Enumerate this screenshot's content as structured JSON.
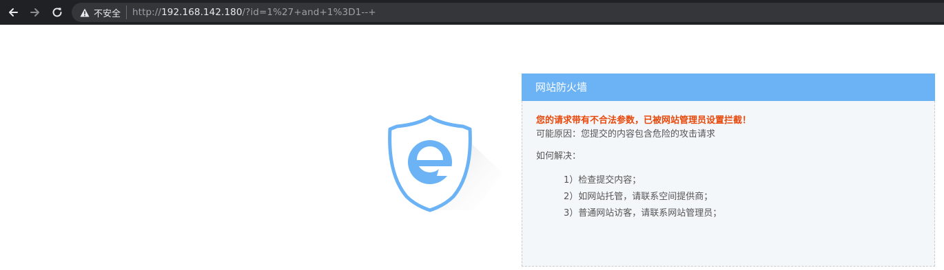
{
  "browser": {
    "security_label": "不安全",
    "url": {
      "scheme": "http://",
      "host": "192.168.142.180",
      "rest": "/?id=1%27+and+1%3D1--+"
    }
  },
  "icons": [
    "back-arrow-icon",
    "forward-arrow-icon",
    "reload-icon",
    "warning-icon",
    "shield-e-logo"
  ],
  "colors": {
    "panel_header": "#6cb3f6",
    "warning_text": "#e8480a",
    "shield": "#6cb3f6"
  },
  "panel": {
    "title": "网站防火墙",
    "warning": "您的请求带有不合法参数，已被网站管理员设置拦截！",
    "reason": "可能原因：您提交的内容包含危险的攻击请求",
    "how_title": "如何解决：",
    "steps": [
      "1）检查提交内容；",
      "2）如网站托管，请联系空间提供商；",
      "3）普通网站访客，请联系网站管理员；"
    ]
  }
}
